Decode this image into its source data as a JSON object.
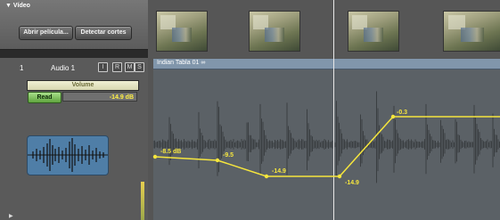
{
  "video": {
    "title": "▼ Vídeo",
    "open_movie_label": "Abrir película...",
    "detect_cuts_label": "Detectar cortes"
  },
  "track": {
    "number": "1",
    "name": "Audio 1",
    "buttons": [
      "I",
      "R",
      "M",
      "S"
    ],
    "automation_param": "Volume",
    "automation_mode": "Read",
    "volume_value": "-14.9 dB"
  },
  "clip": {
    "title": "Indian Tabla 01"
  },
  "automation": {
    "points": [
      {
        "label": "-8.5 dB"
      },
      {
        "label": "-9.5"
      },
      {
        "label": "-14.9"
      },
      {
        "label": "-14.9"
      },
      {
        "label": "-0.3"
      }
    ]
  },
  "colors": {
    "automation_line": "#f6e63d",
    "clip_header": "#8196ab",
    "read_button": "#6fb84a"
  }
}
